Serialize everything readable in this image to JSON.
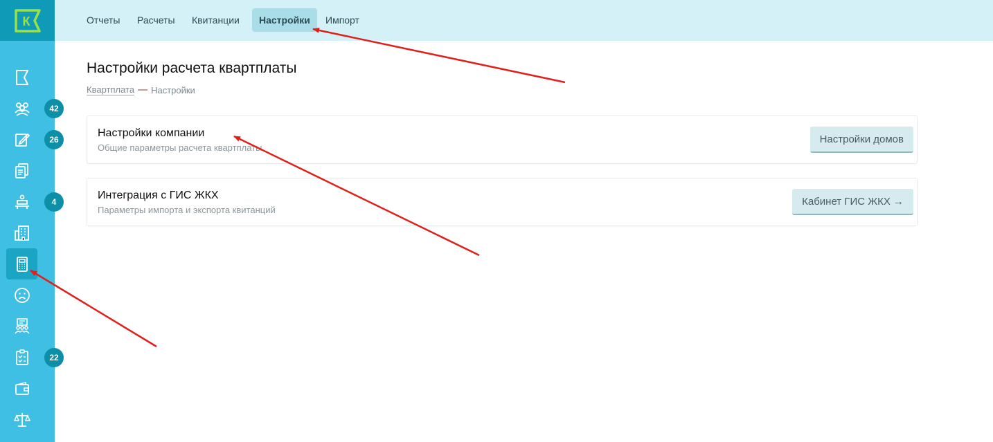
{
  "logo": {
    "letter": "К"
  },
  "sidebar": {
    "items": [
      {
        "icon": "flag-icon",
        "badge": ""
      },
      {
        "icon": "people-icon",
        "badge": "42"
      },
      {
        "icon": "edit-icon",
        "badge": "26"
      },
      {
        "icon": "documents-icon",
        "badge": ""
      },
      {
        "icon": "desk-icon",
        "badge": "4"
      },
      {
        "icon": "building-icon",
        "badge": ""
      },
      {
        "icon": "calculator-icon",
        "badge": ""
      },
      {
        "icon": "sad-face-icon",
        "badge": ""
      },
      {
        "icon": "group-board-icon",
        "badge": ""
      },
      {
        "icon": "checklist-icon",
        "badge": "22"
      },
      {
        "icon": "wallet-icon",
        "badge": ""
      },
      {
        "icon": "scales-icon",
        "badge": ""
      }
    ]
  },
  "nav": {
    "tabs": [
      {
        "label": "Отчеты"
      },
      {
        "label": "Расчеты"
      },
      {
        "label": "Квитанции"
      },
      {
        "label": "Настройки"
      },
      {
        "label": "Импорт"
      }
    ]
  },
  "main": {
    "title": "Настройки расчета квартплаты",
    "breadcrumb": {
      "link": "Квартплата",
      "current": "Настройки"
    },
    "cards": [
      {
        "title": "Настройки компании",
        "subtitle": "Общие параметры расчета квартплаты",
        "button": "Настройки домов"
      },
      {
        "title": "Интеграция с ГИС ЖКХ",
        "subtitle": "Параметры импорта и экспорта квитанций",
        "button": "Кабинет ГИС ЖКХ →"
      }
    ]
  },
  "colors": {
    "sidebar": "#3fbfe3",
    "logo_bg": "#0f9bb7",
    "topbar": "#d3f1f7",
    "active_tab": "#a9dde8",
    "badge": "#0c8fa7",
    "annotation_arrow": "#e0201a"
  }
}
